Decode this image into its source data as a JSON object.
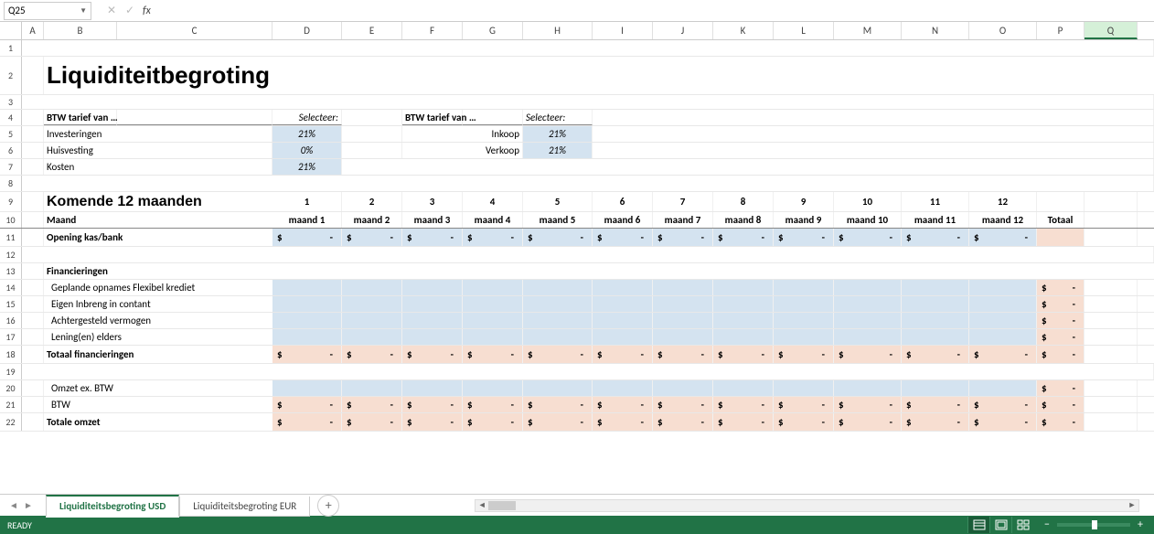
{
  "formula_bar": {
    "cell_ref": "Q25",
    "fx": "fx"
  },
  "columns": [
    "A",
    "B",
    "C",
    "D",
    "E",
    "F",
    "G",
    "H",
    "I",
    "J",
    "K",
    "L",
    "M",
    "N",
    "O",
    "P",
    "Q"
  ],
  "selected_col": "Q",
  "title": "Liquiditeitbegroting",
  "btw1": {
    "header": "BTW tarief van …",
    "sel": "Selecteer:",
    "rows": [
      {
        "label": "Investeringen",
        "val": "21%"
      },
      {
        "label": "Huisvesting",
        "val": "0%"
      },
      {
        "label": "Kosten",
        "val": "21%"
      }
    ]
  },
  "btw2": {
    "header": "BTW tarief van …",
    "sel": "Selecteer:",
    "rows": [
      {
        "label": "Inkoop",
        "val": "21%"
      },
      {
        "label": "Verkoop",
        "val": "21%"
      }
    ]
  },
  "months_header": "Komende 12 maanden",
  "month_nums": [
    "1",
    "2",
    "3",
    "4",
    "5",
    "6",
    "7",
    "8",
    "9",
    "10",
    "11",
    "12"
  ],
  "maand_label": "Maand",
  "maand_cols": [
    "maand 1",
    "maand 2",
    "maand 3",
    "maand 4",
    "maand 5",
    "maand 6",
    "maand 7",
    "maand 8",
    "maand 9",
    "maand 10",
    "maand 11",
    "maand 12"
  ],
  "totaal": "Totaal",
  "opening": "Opening kas/bank",
  "fin_header": "Financieringen",
  "fin_rows": [
    "Geplande opnames Flexibel krediet",
    "Eigen Inbreng in contant",
    "Achtergesteld vermogen",
    "Lening(en) elders"
  ],
  "fin_total": "Totaal financieringen",
  "omzet_rows": [
    "Omzet ex. BTW",
    "BTW"
  ],
  "omzet_total": "Totale omzet",
  "money": {
    "sym": "$",
    "dash": "-"
  },
  "sheets": {
    "active": "Liquiditeitsbegroting USD",
    "other": "Liquiditeitsbegroting EUR"
  },
  "status": {
    "ready": "READY"
  },
  "chart_data": {
    "type": "table",
    "title": "Liquiditeitbegroting",
    "btw_tarieven": {
      "Investeringen": 0.21,
      "Huisvesting": 0.0,
      "Kosten": 0.21,
      "Inkoop": 0.21,
      "Verkoop": 0.21
    },
    "periods": [
      "maand 1",
      "maand 2",
      "maand 3",
      "maand 4",
      "maand 5",
      "maand 6",
      "maand 7",
      "maand 8",
      "maand 9",
      "maand 10",
      "maand 11",
      "maand 12",
      "Totaal"
    ],
    "opening_kas_bank": [
      0,
      0,
      0,
      0,
      0,
      0,
      0,
      0,
      0,
      0,
      0,
      0,
      null
    ],
    "financieringen": {
      "Geplande opnames Flexibel krediet": [
        null,
        null,
        null,
        null,
        null,
        null,
        null,
        null,
        null,
        null,
        null,
        null,
        0
      ],
      "Eigen Inbreng in contant": [
        null,
        null,
        null,
        null,
        null,
        null,
        null,
        null,
        null,
        null,
        null,
        null,
        0
      ],
      "Achtergesteld vermogen": [
        null,
        null,
        null,
        null,
        null,
        null,
        null,
        null,
        null,
        null,
        null,
        null,
        0
      ],
      "Lening(en) elders": [
        null,
        null,
        null,
        null,
        null,
        null,
        null,
        null,
        null,
        null,
        null,
        null,
        0
      ],
      "Totaal financieringen": [
        0,
        0,
        0,
        0,
        0,
        0,
        0,
        0,
        0,
        0,
        0,
        0,
        0
      ]
    },
    "omzet": {
      "Omzet ex. BTW": [
        null,
        null,
        null,
        null,
        null,
        null,
        null,
        null,
        null,
        null,
        null,
        null,
        0
      ],
      "BTW": [
        0,
        0,
        0,
        0,
        0,
        0,
        0,
        0,
        0,
        0,
        0,
        0,
        0
      ],
      "Totale omzet": [
        0,
        0,
        0,
        0,
        0,
        0,
        0,
        0,
        0,
        0,
        0,
        0,
        0
      ]
    }
  }
}
